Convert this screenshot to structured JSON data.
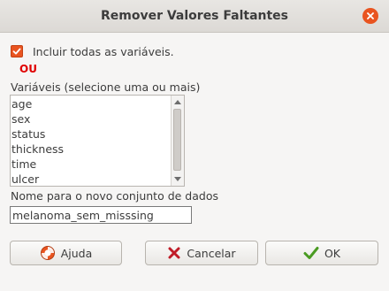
{
  "window": {
    "title": "Remover Valores Faltantes"
  },
  "include_all": {
    "label": "Incluir todas as variáveis.",
    "checked": true
  },
  "ou_label": "OU",
  "variables": {
    "label": "Variáveis (selecione uma ou mais)",
    "items": [
      "age",
      "sex",
      "status",
      "thickness",
      "time",
      "ulcer"
    ]
  },
  "dataset_name": {
    "label": "Nome para o novo conjunto de dados",
    "value": "melanoma_sem_misssing"
  },
  "buttons": {
    "help": "Ajuda",
    "cancel": "Cancelar",
    "ok": "OK"
  },
  "colors": {
    "accent": "#e95420",
    "ou_red": "#e00000",
    "ok_green": "#4a9b22",
    "cancel_red": "#c01c28"
  }
}
